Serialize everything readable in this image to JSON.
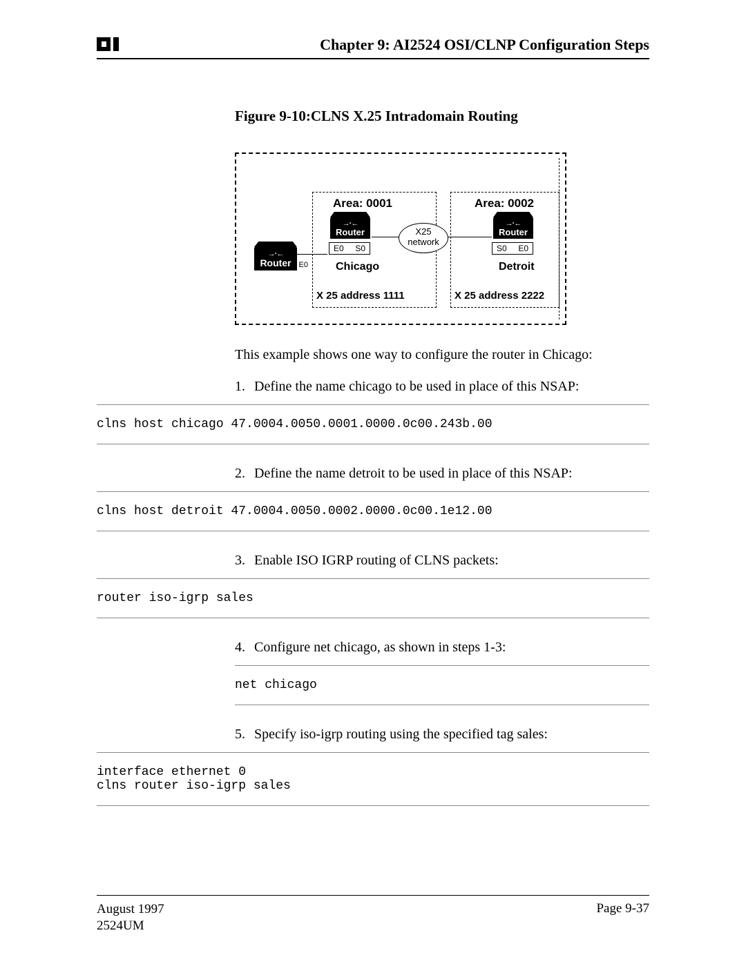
{
  "header": {
    "chapter_title": "Chapter 9: AI2524 OSI/CLNP Configuration Steps"
  },
  "figure": {
    "caption": "Figure 9-10:CLNS X.25 Intradomain Routing",
    "area1": "Area: 0001",
    "area2": "Area: 0002",
    "router_label": "Router",
    "port_e0": "E0",
    "port_s0": "S0",
    "city_chicago": "Chicago",
    "city_detroit": "Detroit",
    "x25_label_1": "X25",
    "x25_label_2": "network",
    "addr1": "X 25 address 1111",
    "addr2": "X 25 address 2222"
  },
  "intro": "This example shows one way to configure the router in Chicago:",
  "steps": {
    "s1": {
      "num": "1.",
      "text": "Define the name chicago to be used in place of this NSAP:"
    },
    "s2": {
      "num": "2.",
      "text": "Define the name detroit to be used in place of this NSAP:"
    },
    "s3": {
      "num": "3.",
      "text": "Enable ISO IGRP routing of CLNS packets:"
    },
    "s4": {
      "num": "4.",
      "text": "Configure net chicago, as shown in steps 1-3:"
    },
    "s5": {
      "num": "5.",
      "text": "Specify iso-igrp routing using the specified tag sales:"
    }
  },
  "code": {
    "c1": "clns host chicago 47.0004.0050.0001.0000.0c00.243b.00",
    "c2": "clns host detroit 47.0004.0050.0002.0000.0c00.1e12.00",
    "c3": "router iso-igrp sales",
    "c4": "net chicago",
    "c5": "interface ethernet 0\nclns router iso-igrp sales"
  },
  "footer": {
    "date": "August 1997",
    "docid": "2524UM",
    "page": "Page 9-37"
  }
}
